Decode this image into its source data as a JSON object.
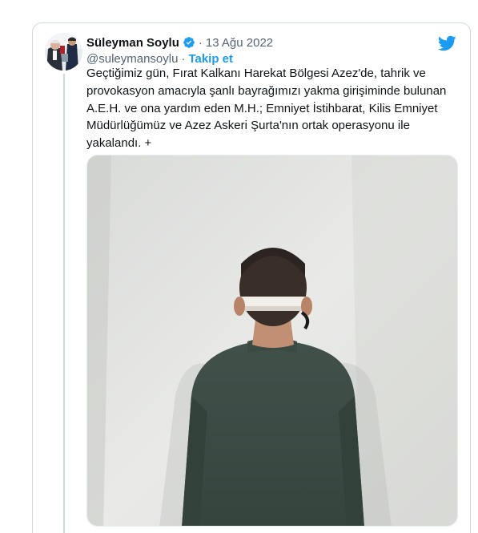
{
  "tweet": {
    "author": {
      "display_name": "Süleyman Soylu",
      "handle": "@suleymansoylu",
      "verified": true,
      "avatar_icon": "profile-photo"
    },
    "date": "13 Ağu 2022",
    "date_separator": "·",
    "handle_separator": "·",
    "follow_label": "Takip et",
    "text_lines": [
      "Geçtiğimiz gün, Fırat Kalkanı Harekat Bölgesi Azez'de, tahrik ve",
      "provokasyon amacıyla şanlı bayrağımızı yakma girişiminde bulunan",
      "A.E.H. ve ona yardım eden M.H.; Emniyet İstihbarat, Kilis Emniyet",
      "Müdürlüğümüz ve Azez Askeri Şurta'nın ortak operasyonu ile",
      "yakalandı. +"
    ],
    "media_icon": "photo-blindfolded-man-back-view"
  },
  "brand": {
    "logo_icon": "twitter-bird-icon",
    "accent_color": "#1d9bf0",
    "text_color": "#0f1419",
    "secondary_color": "#536471"
  }
}
